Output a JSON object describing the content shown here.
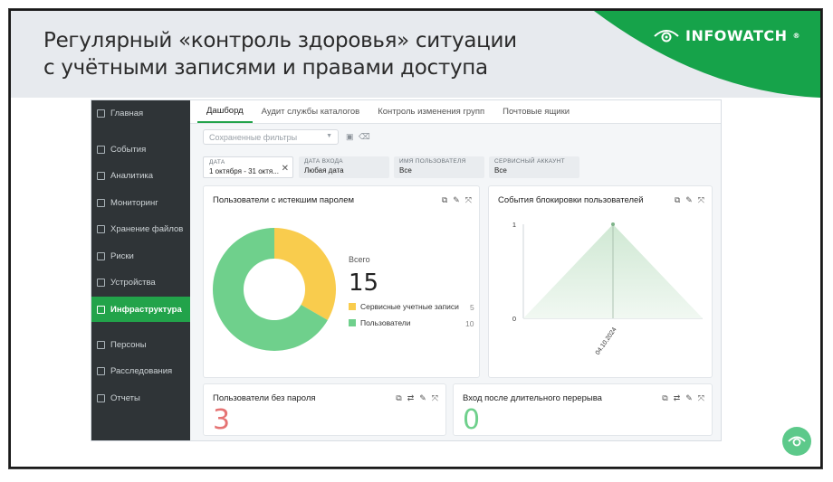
{
  "slide": {
    "title_line1": "Регулярный «контроль здоровья» ситуации",
    "title_line2": "с учётными записями и правами доступа",
    "brand": "INFOWATCH"
  },
  "sidebar": {
    "items": [
      {
        "label": "Главная",
        "icon": "home-icon"
      },
      {
        "label": "События",
        "icon": "events-icon"
      },
      {
        "label": "Аналитика",
        "icon": "analytics-icon"
      },
      {
        "label": "Мониторинг",
        "icon": "monitoring-icon"
      },
      {
        "label": "Хранение файлов",
        "icon": "file-storage-icon"
      },
      {
        "label": "Риски",
        "icon": "risks-icon"
      },
      {
        "label": "Устройства",
        "icon": "devices-icon"
      },
      {
        "label": "Инфраструктура",
        "icon": "infrastructure-icon",
        "active": true
      },
      {
        "label": "Персоны",
        "icon": "persons-icon"
      },
      {
        "label": "Расследования",
        "icon": "investigations-icon"
      },
      {
        "label": "Отчеты",
        "icon": "reports-icon"
      }
    ]
  },
  "tabs": [
    "Дашборд",
    "Аудит службы каталогов",
    "Контроль изменения групп",
    "Почтовые ящики"
  ],
  "saved_filters_placeholder": "Сохраненные фильтры",
  "filters": [
    {
      "label": "Дата",
      "value": "1 октября - 31 октя..."
    },
    {
      "label": "Дата входа",
      "value": "Любая дата"
    },
    {
      "label": "Имя пользователя",
      "value": "Все"
    },
    {
      "label": "Сервисный аккаунт",
      "value": "Все"
    }
  ],
  "cards": {
    "expired_password": {
      "title": "Пользователи с истекшим паролем",
      "total_label": "Всего",
      "total": "15",
      "legend": [
        {
          "label": "Сервисные учетные записи",
          "value": "5",
          "color": "#f9cc4d"
        },
        {
          "label": "Пользователи",
          "value": "10",
          "color": "#6fd08c"
        }
      ]
    },
    "lockout_events": {
      "title": "События блокировки пользователей",
      "y_ticks": [
        "1",
        "0"
      ],
      "x_tick": "04.10.2024"
    },
    "no_password": {
      "title": "Пользователи без пароля",
      "value": "3",
      "color": "#e57373"
    },
    "long_break_login": {
      "title": "Вход после длительного перерыва",
      "value": "0",
      "color": "#6fd08c"
    }
  },
  "chart_data": [
    {
      "type": "pie",
      "title": "Пользователи с истекшим паролем",
      "categories": [
        "Сервисные учетные записи",
        "Пользователи"
      ],
      "values": [
        5,
        10
      ]
    },
    {
      "type": "area",
      "title": "События блокировки пользователей",
      "x": [
        "04.10.2024"
      ],
      "values": [
        1
      ],
      "ylim": [
        0,
        1
      ]
    }
  ]
}
